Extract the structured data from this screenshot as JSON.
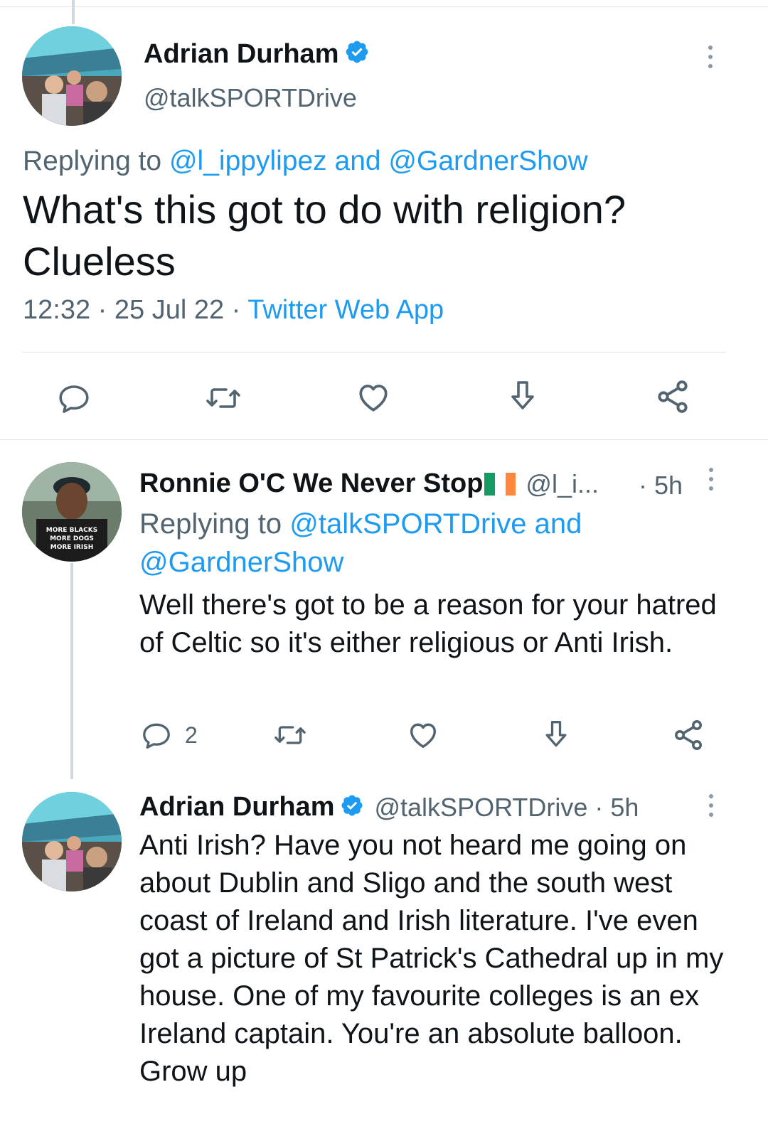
{
  "main_tweet": {
    "author_name": "Adrian Durham",
    "author_handle": "@talkSPORTDrive",
    "replying_prefix": "Replying to",
    "replying_to": "@l_ippylipez and @GardnerShow",
    "text": "What's this got to do with religion? Clueless",
    "time": "12:32",
    "date": "25 Jul 22",
    "source": "Twitter Web App",
    "separator": "·"
  },
  "reply_1": {
    "author_name": "Ronnie O'C We Never Stop",
    "author_handle": "@l_i...",
    "age": "· 5h",
    "replying_prefix": "Replying to",
    "replying_to_line1": "@talkSPORTDrive and",
    "replying_to_line2": "@GardnerShow",
    "text": "Well there's got to be a reason for your hatred of Celtic so it's either religious or Anti Irish.",
    "reply_count": "2",
    "shirt_text": [
      "MORE BLACKS",
      "MORE DOGS",
      "MORE IRISH"
    ]
  },
  "reply_2": {
    "author_name": "Adrian Durham",
    "author_handle": "@talkSPORTDrive",
    "age": "· 5h",
    "text": "Anti Irish? Have you not heard me going on about Dublin and Sligo and the south west coast of Ireland and Irish literature. I've even got a picture of St Patrick's Cathedral up in my house. One of my favourite colleges is an ex Ireland captain. You're an absolute balloon. Grow up"
  },
  "icons": {
    "reply": "speech-bubble-icon",
    "retweet": "retweet-icon",
    "like": "heart-icon",
    "download": "download-arrow-icon",
    "share": "share-nodes-icon",
    "verified": "verified-badge-icon",
    "more": "vertical-dots-icon"
  },
  "colors": {
    "link": "#1d9bf0",
    "secondary_text": "#536471",
    "icon": "#536471",
    "verified": "#1d9bf0",
    "flag_green": "#169b62",
    "flag_white": "#ffffff",
    "flag_orange": "#ff883e"
  }
}
